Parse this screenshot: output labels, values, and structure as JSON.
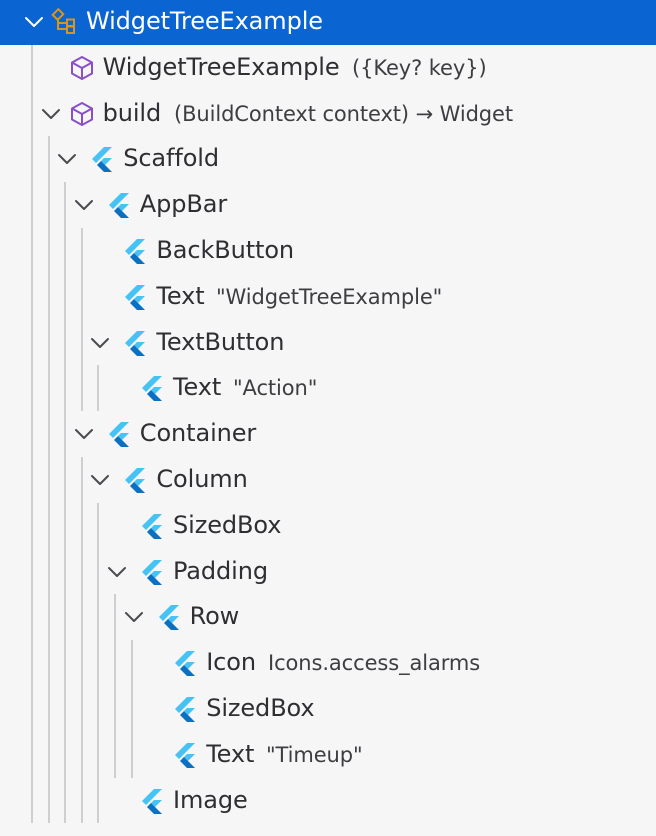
{
  "tree": {
    "nodes": [
      {
        "depth": 0,
        "expanded": true,
        "icon": "class-icon",
        "label": "WidgetTreeExample",
        "detail": "",
        "selected": true
      },
      {
        "depth": 1,
        "expanded": null,
        "icon": "method-icon",
        "label": "WidgetTreeExample",
        "detail": "({Key? key})"
      },
      {
        "depth": 1,
        "expanded": true,
        "icon": "method-icon",
        "label": "build",
        "detail": "(BuildContext context) → Widget"
      },
      {
        "depth": 2,
        "expanded": true,
        "icon": "flutter-icon",
        "label": "Scaffold",
        "detail": ""
      },
      {
        "depth": 3,
        "expanded": true,
        "icon": "flutter-icon",
        "label": "AppBar",
        "detail": ""
      },
      {
        "depth": 4,
        "expanded": null,
        "icon": "flutter-icon",
        "label": "BackButton",
        "detail": ""
      },
      {
        "depth": 4,
        "expanded": null,
        "icon": "flutter-icon",
        "label": "Text",
        "detail": "\"WidgetTreeExample\""
      },
      {
        "depth": 4,
        "expanded": true,
        "icon": "flutter-icon",
        "label": "TextButton",
        "detail": ""
      },
      {
        "depth": 5,
        "expanded": null,
        "icon": "flutter-icon",
        "label": "Text",
        "detail": "\"Action\""
      },
      {
        "depth": 3,
        "expanded": true,
        "icon": "flutter-icon",
        "label": "Container",
        "detail": ""
      },
      {
        "depth": 4,
        "expanded": true,
        "icon": "flutter-icon",
        "label": "Column",
        "detail": ""
      },
      {
        "depth": 5,
        "expanded": null,
        "icon": "flutter-icon",
        "label": "SizedBox",
        "detail": ""
      },
      {
        "depth": 5,
        "expanded": true,
        "icon": "flutter-icon",
        "label": "Padding",
        "detail": ""
      },
      {
        "depth": 6,
        "expanded": true,
        "icon": "flutter-icon",
        "label": "Row",
        "detail": ""
      },
      {
        "depth": 7,
        "expanded": null,
        "icon": "flutter-icon",
        "label": "Icon",
        "detail": "Icons.access_alarms"
      },
      {
        "depth": 7,
        "expanded": null,
        "icon": "flutter-icon",
        "label": "SizedBox",
        "detail": ""
      },
      {
        "depth": 7,
        "expanded": null,
        "icon": "flutter-icon",
        "label": "Text",
        "detail": "\"Timeup\""
      },
      {
        "depth": 5,
        "expanded": null,
        "icon": "flutter-icon",
        "label": "Image",
        "detail": ""
      }
    ]
  },
  "colors": {
    "selection": "#0a64d2",
    "class_icon": "#d9941e",
    "method_icon": "#8a4fc8",
    "flutter_light": "#45c3f5",
    "flutter_dark": "#0b6fc2",
    "chevron": "#4a4a4f",
    "guide": "#cfcfd3"
  }
}
